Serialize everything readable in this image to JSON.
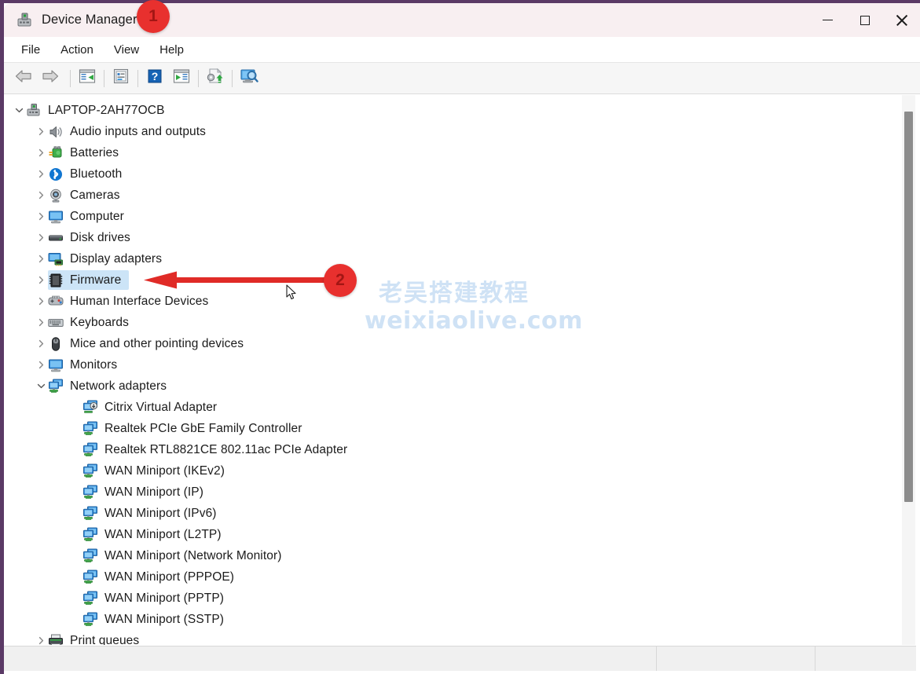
{
  "window": {
    "title": "Device Manager",
    "icon": "device-manager-icon",
    "controls": {
      "minimize": "minimize-icon",
      "maximize": "maximize-icon",
      "close": "close-icon"
    }
  },
  "menubar": {
    "items": [
      {
        "label": "File"
      },
      {
        "label": "Action"
      },
      {
        "label": "View"
      },
      {
        "label": "Help"
      }
    ]
  },
  "toolbar": {
    "buttons": [
      {
        "name": "back-icon"
      },
      {
        "name": "forward-icon"
      },
      {
        "name": "show-hide-console-tree-icon"
      },
      {
        "name": "properties-icon"
      },
      {
        "name": "help-icon"
      },
      {
        "name": "scan-for-hardware-changes-icon"
      },
      {
        "name": "update-driver-icon"
      },
      {
        "name": "devices-by-connection-icon"
      }
    ]
  },
  "tree": {
    "root": {
      "label": "LAPTOP-2AH77OCB",
      "icon": "computer-root-icon",
      "expanded": true
    },
    "nodes": [
      {
        "label": "Audio inputs and outputs",
        "icon": "speaker-icon",
        "level": 1,
        "expandable": true,
        "expanded": false,
        "selected": false
      },
      {
        "label": "Batteries",
        "icon": "battery-icon",
        "level": 1,
        "expandable": true,
        "expanded": false,
        "selected": false
      },
      {
        "label": "Bluetooth",
        "icon": "bluetooth-icon",
        "level": 1,
        "expandable": true,
        "expanded": false,
        "selected": false
      },
      {
        "label": "Cameras",
        "icon": "camera-icon",
        "level": 1,
        "expandable": true,
        "expanded": false,
        "selected": false
      },
      {
        "label": "Computer",
        "icon": "monitor-icon",
        "level": 1,
        "expandable": true,
        "expanded": false,
        "selected": false
      },
      {
        "label": "Disk drives",
        "icon": "disk-drive-icon",
        "level": 1,
        "expandable": true,
        "expanded": false,
        "selected": false
      },
      {
        "label": "Display adapters",
        "icon": "display-adapter-icon",
        "level": 1,
        "expandable": true,
        "expanded": false,
        "selected": false
      },
      {
        "label": "Firmware",
        "icon": "firmware-chip-icon",
        "level": 1,
        "expandable": true,
        "expanded": false,
        "selected": true
      },
      {
        "label": "Human Interface Devices",
        "icon": "hid-gamepad-icon",
        "level": 1,
        "expandable": true,
        "expanded": false,
        "selected": false
      },
      {
        "label": "Keyboards",
        "icon": "keyboard-icon",
        "level": 1,
        "expandable": true,
        "expanded": false,
        "selected": false
      },
      {
        "label": "Mice and other pointing devices",
        "icon": "mouse-icon",
        "level": 1,
        "expandable": true,
        "expanded": false,
        "selected": false
      },
      {
        "label": "Monitors",
        "icon": "monitor-icon",
        "level": 1,
        "expandable": true,
        "expanded": false,
        "selected": false
      },
      {
        "label": "Network adapters",
        "icon": "network-adapter-icon",
        "level": 1,
        "expandable": true,
        "expanded": true,
        "selected": false
      },
      {
        "label": "Citrix Virtual Adapter",
        "icon": "virtual-adapter-icon",
        "level": 2,
        "expandable": false,
        "expanded": false,
        "selected": false
      },
      {
        "label": "Realtek PCIe GbE Family Controller",
        "icon": "network-adapter-icon",
        "level": 2,
        "expandable": false,
        "expanded": false,
        "selected": false
      },
      {
        "label": "Realtek RTL8821CE 802.11ac PCIe Adapter",
        "icon": "network-adapter-icon",
        "level": 2,
        "expandable": false,
        "expanded": false,
        "selected": false
      },
      {
        "label": "WAN Miniport (IKEv2)",
        "icon": "network-adapter-icon",
        "level": 2,
        "expandable": false,
        "expanded": false,
        "selected": false
      },
      {
        "label": "WAN Miniport (IP)",
        "icon": "network-adapter-icon",
        "level": 2,
        "expandable": false,
        "expanded": false,
        "selected": false
      },
      {
        "label": "WAN Miniport (IPv6)",
        "icon": "network-adapter-icon",
        "level": 2,
        "expandable": false,
        "expanded": false,
        "selected": false
      },
      {
        "label": "WAN Miniport (L2TP)",
        "icon": "network-adapter-icon",
        "level": 2,
        "expandable": false,
        "expanded": false,
        "selected": false
      },
      {
        "label": "WAN Miniport (Network Monitor)",
        "icon": "network-adapter-icon",
        "level": 2,
        "expandable": false,
        "expanded": false,
        "selected": false
      },
      {
        "label": "WAN Miniport (PPPOE)",
        "icon": "network-adapter-icon",
        "level": 2,
        "expandable": false,
        "expanded": false,
        "selected": false
      },
      {
        "label": "WAN Miniport (PPTP)",
        "icon": "network-adapter-icon",
        "level": 2,
        "expandable": false,
        "expanded": false,
        "selected": false
      },
      {
        "label": "WAN Miniport (SSTP)",
        "icon": "network-adapter-icon",
        "level": 2,
        "expandable": false,
        "expanded": false,
        "selected": false
      },
      {
        "label": "Print queues",
        "icon": "printer-icon",
        "level": 1,
        "expandable": true,
        "expanded": false,
        "selected": false
      }
    ]
  },
  "annotations": {
    "badges": [
      {
        "label": "1",
        "target": "window-title"
      },
      {
        "label": "2",
        "target": "tree-node-firmware"
      }
    ],
    "arrow": {
      "name": "callout-arrow-to-firmware",
      "color": "#e02b27",
      "direction": "left"
    },
    "badge_color": "#e8302e"
  },
  "watermark": {
    "line1": "老吴搭建教程",
    "line2": "weixiaolive.com",
    "color": "#cfe2f5"
  },
  "statusbar": {
    "panes": [
      "",
      "",
      ""
    ]
  },
  "cursor": {
    "name": "mouse-pointer"
  }
}
